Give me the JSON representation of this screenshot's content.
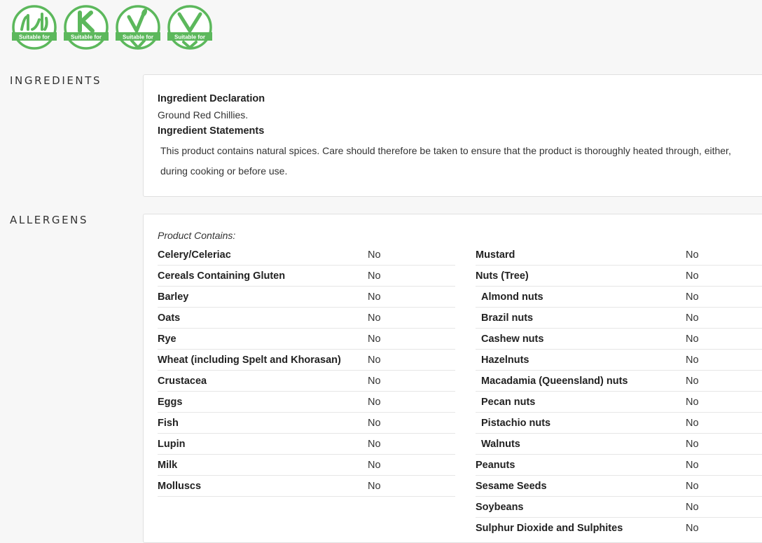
{
  "badges": [
    {
      "icon": "halal-icon",
      "caption": "Suitable for"
    },
    {
      "icon": "kosher-icon",
      "caption": "Suitable for"
    },
    {
      "icon": "vegetarian-icon",
      "caption": "Suitable for"
    },
    {
      "icon": "vegan-icon",
      "caption": "Suitable for"
    }
  ],
  "accent_color": "#5cb85c",
  "ingredients": {
    "section_title": "INGREDIENTS",
    "declaration_heading": "Ingredient Declaration",
    "declaration_text": "Ground Red Chillies.",
    "statements_heading": "Ingredient Statements",
    "statements_text": "This product contains natural spices. Care should therefore be taken to ensure that the product is thoroughly heated through, either, during cooking or before use."
  },
  "allergens": {
    "section_title": "ALLERGENS",
    "contains_label": "Product Contains:",
    "left": [
      {
        "name": "Celery/Celeriac",
        "value": "No"
      },
      {
        "name": "Cereals Containing Gluten",
        "value": "No"
      },
      {
        "name": "Barley",
        "value": "No"
      },
      {
        "name": "Oats",
        "value": "No"
      },
      {
        "name": "Rye",
        "value": "No"
      },
      {
        "name": "Wheat (including Spelt and Khorasan)",
        "value": "No"
      },
      {
        "name": "Crustacea",
        "value": "No"
      },
      {
        "name": "Eggs",
        "value": "No"
      },
      {
        "name": "Fish",
        "value": "No"
      },
      {
        "name": "Lupin",
        "value": "No"
      },
      {
        "name": "Milk",
        "value": "No"
      },
      {
        "name": "Molluscs",
        "value": "No"
      }
    ],
    "right": [
      {
        "name": "Mustard",
        "value": "No",
        "sub": false
      },
      {
        "name": "Nuts (Tree)",
        "value": "No",
        "sub": false
      },
      {
        "name": "Almond nuts",
        "value": "No",
        "sub": true
      },
      {
        "name": "Brazil nuts",
        "value": "No",
        "sub": true
      },
      {
        "name": "Cashew nuts",
        "value": "No",
        "sub": true
      },
      {
        "name": "Hazelnuts",
        "value": "No",
        "sub": true
      },
      {
        "name": "Macadamia (Queensland) nuts",
        "value": "No",
        "sub": true
      },
      {
        "name": "Pecan nuts",
        "value": "No",
        "sub": true
      },
      {
        "name": "Pistachio nuts",
        "value": "No",
        "sub": true
      },
      {
        "name": "Walnuts",
        "value": "No",
        "sub": true
      },
      {
        "name": "Peanuts",
        "value": "No",
        "sub": false
      },
      {
        "name": "Sesame Seeds",
        "value": "No",
        "sub": false
      },
      {
        "name": "Soybeans",
        "value": "No",
        "sub": false
      },
      {
        "name": "Sulphur Dioxide and Sulphites",
        "value": "No",
        "sub": false
      }
    ]
  }
}
